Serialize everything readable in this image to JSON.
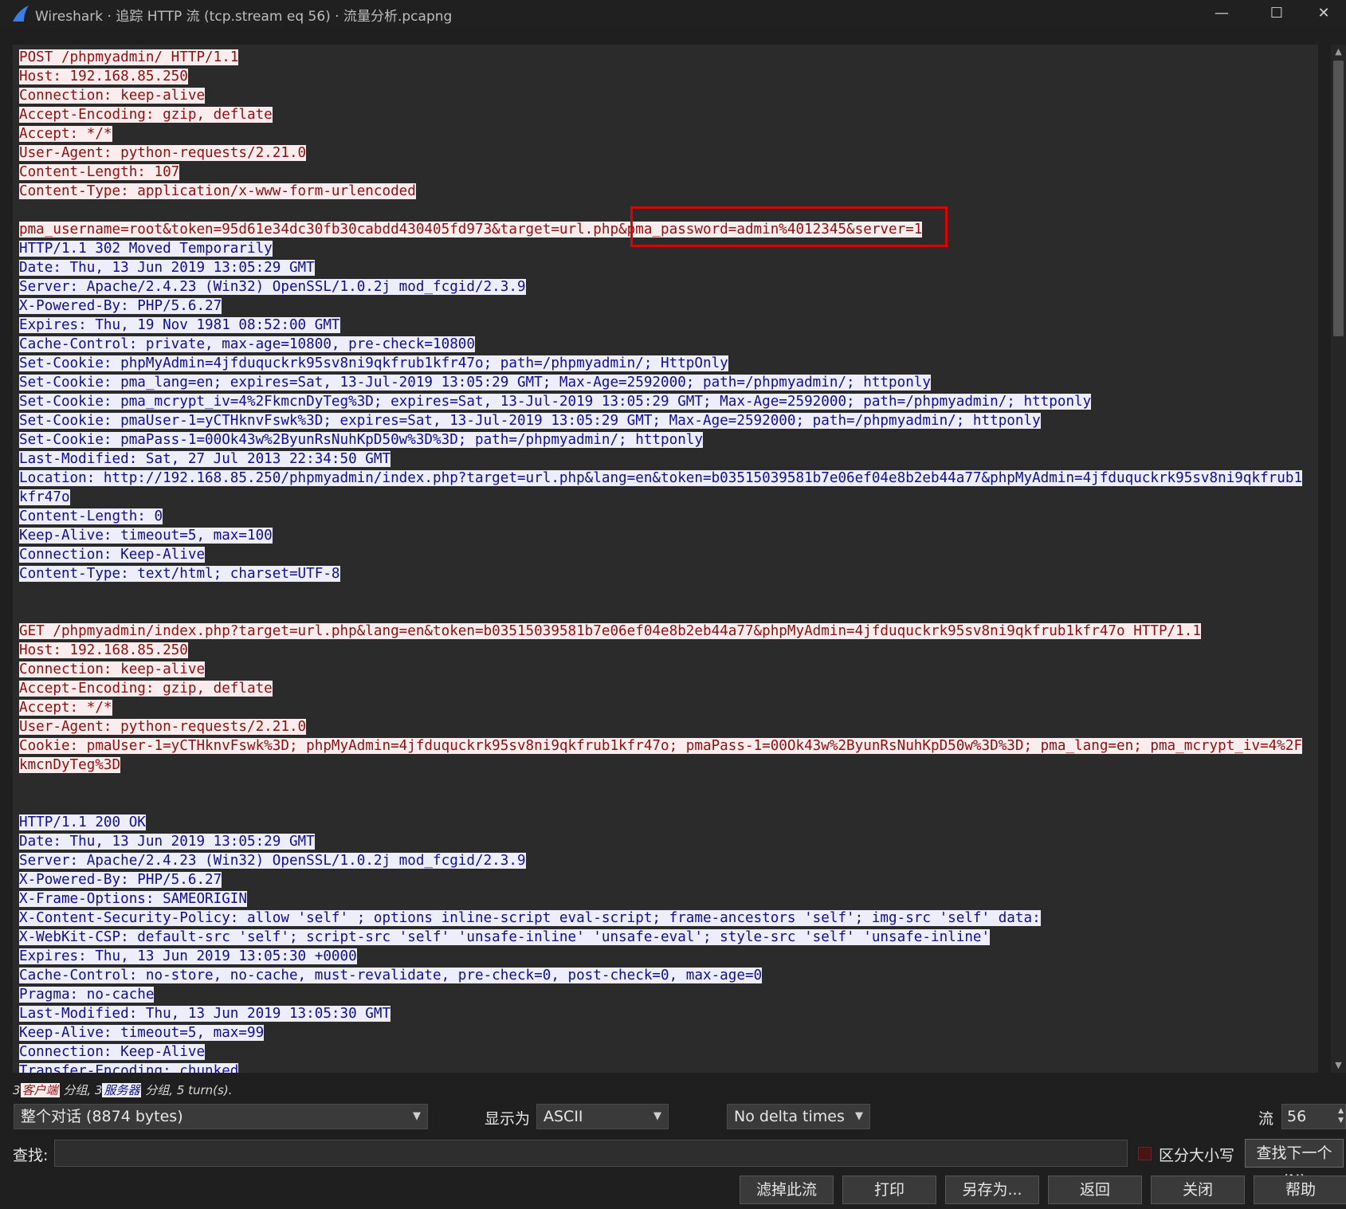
{
  "window": {
    "title": "Wireshark · 追踪 HTTP 流 (tcp.stream eq 56) · 流量分析.pcapng",
    "minimize_glyph": "—",
    "maximize_glyph": "☐",
    "close_glyph": "✕"
  },
  "colors": {
    "client_bg": "#fbeded",
    "client_fg": "#8b1010",
    "server_bg": "#ededfb",
    "server_fg": "#10108b",
    "highlight_box": "#e00000"
  },
  "stream": {
    "lines": [
      {
        "side": "client",
        "text": "POST /phpmyadmin/ HTTP/1.1"
      },
      {
        "side": "client",
        "text": "Host: 192.168.85.250"
      },
      {
        "side": "client",
        "text": "Connection: keep-alive"
      },
      {
        "side": "client",
        "text": "Accept-Encoding: gzip, deflate"
      },
      {
        "side": "client",
        "text": "Accept: */*"
      },
      {
        "side": "client",
        "text": "User-Agent: python-requests/2.21.0"
      },
      {
        "side": "client",
        "text": "Content-Length: 107"
      },
      {
        "side": "client",
        "text": "Content-Type: application/x-www-form-urlencoded"
      },
      {
        "side": "blank",
        "text": ""
      },
      {
        "side": "client",
        "text": "pma_username=root&token=95d61e34dc30fb30cabdd430405fd973&target=url.php&pma_password=admin%4012345&server=1"
      },
      {
        "side": "server",
        "text": "HTTP/1.1 302 Moved Temporarily"
      },
      {
        "side": "server",
        "text": "Date: Thu, 13 Jun 2019 13:05:29 GMT"
      },
      {
        "side": "server",
        "text": "Server: Apache/2.4.23 (Win32) OpenSSL/1.0.2j mod_fcgid/2.3.9"
      },
      {
        "side": "server",
        "text": "X-Powered-By: PHP/5.6.27"
      },
      {
        "side": "server",
        "text": "Expires: Thu, 19 Nov 1981 08:52:00 GMT"
      },
      {
        "side": "server",
        "text": "Cache-Control: private, max-age=10800, pre-check=10800"
      },
      {
        "side": "server",
        "text": "Set-Cookie: phpMyAdmin=4jfduquckrk95sv8ni9qkfrub1kfr47o; path=/phpmyadmin/; HttpOnly"
      },
      {
        "side": "server",
        "text": "Set-Cookie: pma_lang=en; expires=Sat, 13-Jul-2019 13:05:29 GMT; Max-Age=2592000; path=/phpmyadmin/; httponly"
      },
      {
        "side": "server",
        "text": "Set-Cookie: pma_mcrypt_iv=4%2FkmcnDyTeg%3D; expires=Sat, 13-Jul-2019 13:05:29 GMT; Max-Age=2592000; path=/phpmyadmin/; httponly"
      },
      {
        "side": "server",
        "text": "Set-Cookie: pmaUser-1=yCTHknvFswk%3D; expires=Sat, 13-Jul-2019 13:05:29 GMT; Max-Age=2592000; path=/phpmyadmin/; httponly"
      },
      {
        "side": "server",
        "text": "Set-Cookie: pmaPass-1=00Ok43w%2ByunRsNuhKpD50w%3D%3D; path=/phpmyadmin/; httponly"
      },
      {
        "side": "server",
        "text": "Last-Modified: Sat, 27 Jul 2013 22:34:50 GMT"
      },
      {
        "side": "server",
        "text": "Location: http://192.168.85.250/phpmyadmin/index.php?target=url.php&lang=en&token=b03515039581b7e06ef04e8b2eb44a77&phpMyAdmin=4jfduquckrk95sv8ni9qkfrub1"
      },
      {
        "side": "server",
        "text": "kfr47o"
      },
      {
        "side": "server",
        "text": "Content-Length: 0"
      },
      {
        "side": "server",
        "text": "Keep-Alive: timeout=5, max=100"
      },
      {
        "side": "server",
        "text": "Connection: Keep-Alive"
      },
      {
        "side": "server",
        "text": "Content-Type: text/html; charset=UTF-8"
      },
      {
        "side": "blank",
        "text": ""
      },
      {
        "side": "blank",
        "text": ""
      },
      {
        "side": "client",
        "text": "GET /phpmyadmin/index.php?target=url.php&lang=en&token=b03515039581b7e06ef04e8b2eb44a77&phpMyAdmin=4jfduquckrk95sv8ni9qkfrub1kfr47o HTTP/1.1"
      },
      {
        "side": "client",
        "text": "Host: 192.168.85.250"
      },
      {
        "side": "client",
        "text": "Connection: keep-alive"
      },
      {
        "side": "client",
        "text": "Accept-Encoding: gzip, deflate"
      },
      {
        "side": "client",
        "text": "Accept: */*"
      },
      {
        "side": "client",
        "text": "User-Agent: python-requests/2.21.0"
      },
      {
        "side": "client",
        "text": "Cookie: pmaUser-1=yCTHknvFswk%3D; phpMyAdmin=4jfduquckrk95sv8ni9qkfrub1kfr47o; pmaPass-1=00Ok43w%2ByunRsNuhKpD50w%3D%3D; pma_lang=en; pma_mcrypt_iv=4%2F"
      },
      {
        "side": "client",
        "text": "kmcnDyTeg%3D"
      },
      {
        "side": "blank",
        "text": ""
      },
      {
        "side": "blank",
        "text": ""
      },
      {
        "side": "server",
        "text": "HTTP/1.1 200 OK"
      },
      {
        "side": "server",
        "text": "Date: Thu, 13 Jun 2019 13:05:29 GMT"
      },
      {
        "side": "server",
        "text": "Server: Apache/2.4.23 (Win32) OpenSSL/1.0.2j mod_fcgid/2.3.9"
      },
      {
        "side": "server",
        "text": "X-Powered-By: PHP/5.6.27"
      },
      {
        "side": "server",
        "text": "X-Frame-Options: SAMEORIGIN"
      },
      {
        "side": "server",
        "text": "X-Content-Security-Policy: allow 'self' ; options inline-script eval-script; frame-ancestors 'self'; img-src 'self' data:"
      },
      {
        "side": "server",
        "text": "X-WebKit-CSP: default-src 'self'; script-src 'self' 'unsafe-inline' 'unsafe-eval'; style-src 'self' 'unsafe-inline'"
      },
      {
        "side": "server",
        "text": "Expires: Thu, 13 Jun 2019 13:05:30 +0000"
      },
      {
        "side": "server",
        "text": "Cache-Control: no-store, no-cache, must-revalidate, pre-check=0, post-check=0, max-age=0"
      },
      {
        "side": "server",
        "text": "Pragma: no-cache"
      },
      {
        "side": "server",
        "text": "Last-Modified: Thu, 13 Jun 2019 13:05:30 GMT"
      },
      {
        "side": "server",
        "text": "Keep-Alive: timeout=5, max=99"
      },
      {
        "side": "server",
        "text": "Connection: Keep-Alive"
      },
      {
        "side": "server",
        "text": "Transfer-Encoding: chunked"
      }
    ]
  },
  "status": {
    "client_count": "3",
    "client_label": "客户端",
    "client_suffix": "分组,",
    "server_count": "3",
    "server_label": "服务器",
    "server_suffix": "分组,",
    "turns": "5 turn(s)."
  },
  "controls": {
    "conversation_select": "整个对话 (8874 bytes)",
    "show_as_label": "显示为",
    "show_as_value": "ASCII",
    "delta_select": "No delta times",
    "stream_label": "流",
    "stream_value": "56",
    "find_label": "查找:",
    "find_value": "",
    "case_label": "区分大小写",
    "find_next": "查找下一个(N)"
  },
  "buttons": {
    "filter_out": "滤掉此流",
    "print": "打印",
    "save_as": "另存为...",
    "back": "返回",
    "close": "关闭",
    "help": "帮助"
  }
}
